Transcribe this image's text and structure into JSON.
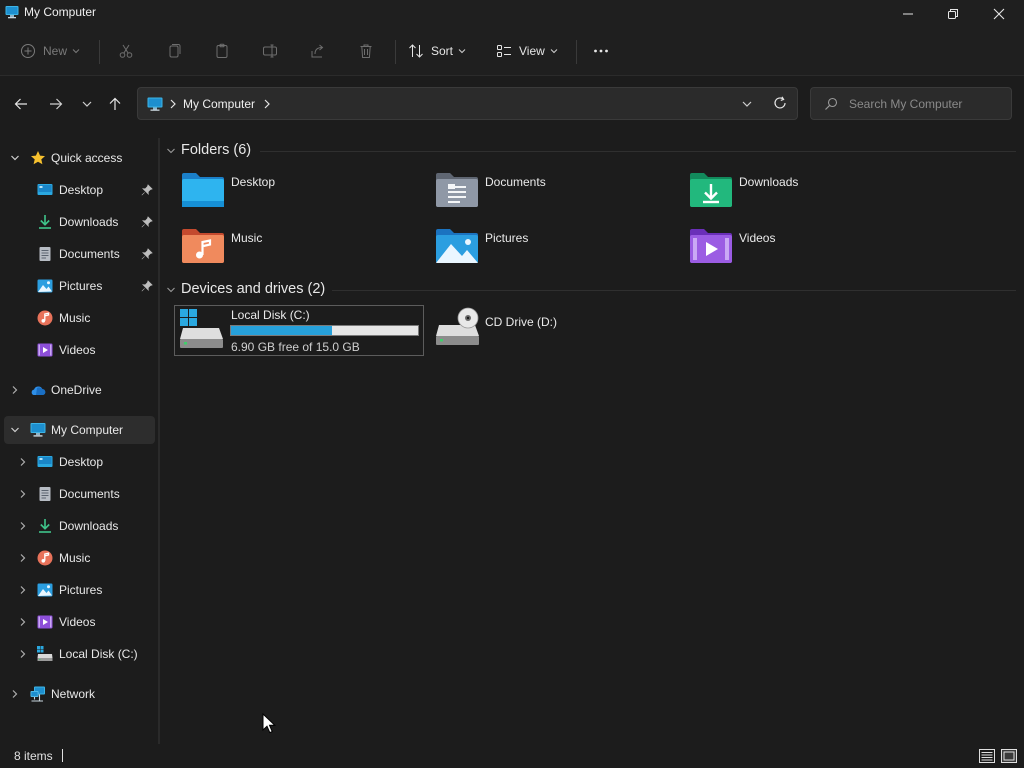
{
  "window": {
    "title": "My Computer"
  },
  "toolbar": {
    "new_label": "New",
    "sort_label": "Sort",
    "view_label": "View"
  },
  "address": {
    "crumb": "My Computer",
    "search_placeholder": "Search My Computer"
  },
  "sidebar": {
    "quick_access": "Quick access",
    "quick_items": [
      {
        "label": "Desktop",
        "icon": "desktop-icon"
      },
      {
        "label": "Downloads",
        "icon": "downloads-icon"
      },
      {
        "label": "Documents",
        "icon": "documents-icon"
      },
      {
        "label": "Pictures",
        "icon": "pictures-icon"
      },
      {
        "label": "Music",
        "icon": "music-icon"
      },
      {
        "label": "Videos",
        "icon": "videos-icon"
      }
    ],
    "onedrive": "OneDrive",
    "my_computer": "My Computer",
    "computer_items": [
      {
        "label": "Desktop",
        "icon": "desktop-icon"
      },
      {
        "label": "Documents",
        "icon": "documents-icon"
      },
      {
        "label": "Downloads",
        "icon": "downloads-icon"
      },
      {
        "label": "Music",
        "icon": "music-icon"
      },
      {
        "label": "Pictures",
        "icon": "pictures-icon"
      },
      {
        "label": "Videos",
        "icon": "videos-icon"
      },
      {
        "label": "Local Disk (C:)",
        "icon": "drive-icon"
      }
    ],
    "network": "Network"
  },
  "content": {
    "folders_heading": "Folders (6)",
    "folders": [
      {
        "label": "Desktop",
        "icon": "desktop-folder-icon"
      },
      {
        "label": "Documents",
        "icon": "documents-folder-icon"
      },
      {
        "label": "Downloads",
        "icon": "downloads-folder-icon"
      },
      {
        "label": "Music",
        "icon": "music-folder-icon"
      },
      {
        "label": "Pictures",
        "icon": "pictures-folder-icon"
      },
      {
        "label": "Videos",
        "icon": "videos-folder-icon"
      }
    ],
    "devices_heading": "Devices and drives (2)",
    "local_disk": {
      "name": "Local Disk (C:)",
      "free_text": "6.90 GB free of 15.0 GB",
      "used_fraction": 0.54
    },
    "cd_drive": {
      "name": "CD Drive (D:)"
    }
  },
  "status": {
    "count": "8 items"
  },
  "colors": {
    "accent": "#26a0da",
    "background": "#1c1c1c"
  }
}
